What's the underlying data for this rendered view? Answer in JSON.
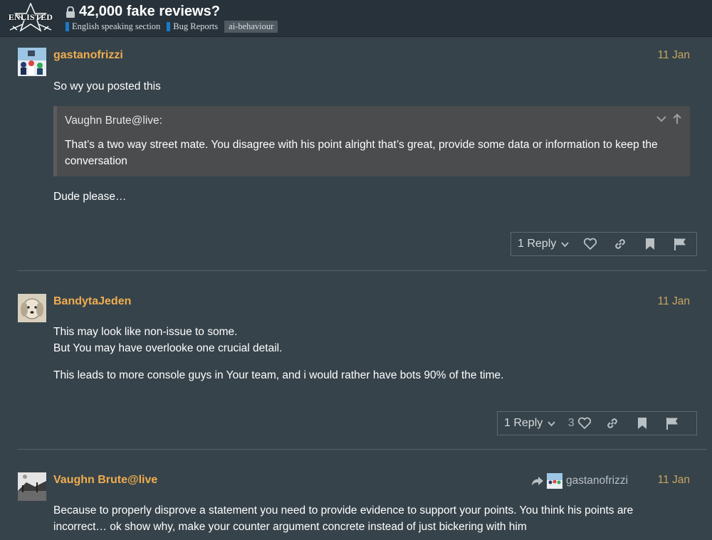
{
  "header": {
    "logo_text": "ENLISTED",
    "title": "42,000 fake reviews?",
    "breadcrumbs": [
      {
        "label": "English speaking section",
        "color": "#1a7ac9"
      },
      {
        "label": "Bug Reports",
        "color": "#1a7ac9"
      }
    ],
    "tag": "ai-behaviour"
  },
  "posts": [
    {
      "username": "gastanofrizzi",
      "date": "11 Jan",
      "paragraphs": [
        "So wy you posted this",
        "Dude please…"
      ],
      "quote": {
        "author": "Vaughn Brute@live:",
        "text": "That’s a two way street mate. You disagree with his point alright that’s great, provide some data or information to keep the conversation"
      },
      "reply_label": "1 Reply"
    },
    {
      "username": "BandytaJeden",
      "date": "11 Jan",
      "paragraphs": [
        "This may look like non-issue to some.",
        "But You may have overlooke one crucial detail.",
        "This leads to more console guys in Your team, and i would rather have bots 90% of the time."
      ],
      "reply_label": "1 Reply",
      "like_count": "3"
    },
    {
      "username": "Vaughn Brute@live",
      "date": "11 Jan",
      "reply_to": "gastanofrizzi",
      "paragraphs": [
        "Because to properly disprove a statement you need to provide evidence to support your points. You think his points are incorrect… ok show why, make your counter argument concrete instead of just bickering with him"
      ]
    }
  ],
  "colors": {
    "username": "#f0ad4e",
    "date": "#c8a65f",
    "background": "#36434b",
    "header": "#27323a"
  }
}
